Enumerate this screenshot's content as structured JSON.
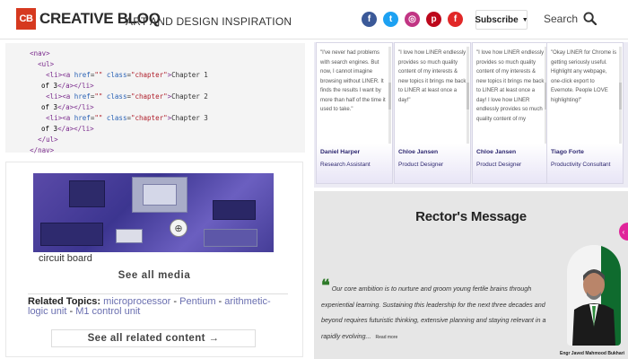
{
  "header": {
    "logo_mark": "CB",
    "logo_text": "CREATIVE BLOQ",
    "tagline": "ART AND DESIGN INSPIRATION",
    "social": [
      {
        "icon": "facebook-icon",
        "glyph": "f",
        "color": "#3b5998"
      },
      {
        "icon": "twitter-icon",
        "glyph": "t",
        "color": "#1da1f2"
      },
      {
        "icon": "instagram-icon",
        "glyph": "◎",
        "color": "#c13584"
      },
      {
        "icon": "pinterest-icon",
        "glyph": "p",
        "color": "#bd081c"
      },
      {
        "icon": "flipboard-icon",
        "glyph": "f",
        "color": "#e12828"
      }
    ],
    "subscribe_label": "Subscribe",
    "subscribe_caret": "▼",
    "search_label": "Search"
  },
  "code": {
    "lines": [
      {
        "indent": "      ",
        "open": "<nav>",
        "rest": ""
      },
      {
        "indent": "        ",
        "open": "<ul>",
        "rest": ""
      },
      {
        "indent": "          ",
        "li": true,
        "text": "Chapter 1",
        "tail": "of 3"
      },
      {
        "indent": "          ",
        "li": true,
        "text": "Chapter 2",
        "tail": "of 3"
      },
      {
        "indent": "          ",
        "li": true,
        "text": "Chapter 3",
        "tail": "of 3"
      },
      {
        "indent": "        ",
        "open": "</ul>",
        "rest": ""
      },
      {
        "indent": "      ",
        "open": "</nav>",
        "rest": ""
      }
    ]
  },
  "media": {
    "caption": "circuit board",
    "see_all_media": "See all media",
    "related_label": "Related Topics:",
    "related_topics": [
      "microprocessor",
      "Pentium",
      "arithmetic-logic unit",
      "M1 control unit"
    ],
    "see_all_related": "See all related content →"
  },
  "testimonials": [
    {
      "quote": "\"I've never had problems with search engines. But now, I cannot imagine browsing without LINER. It finds the results I want by more than half of the time it used to take.\"",
      "name": "Daniel Harper",
      "role": "Research Assistant"
    },
    {
      "quote": "\"I love how LINER endlessly provides so much quality content of my interests & new topics it brings me back to LINER at least once a day!\"",
      "name": "Chloe Jansen",
      "role": "Product Designer"
    },
    {
      "quote": "\"I love how LINER endlessly provides so much quality content of my interests & new topics it brings me back to LINER at least once a day! I love how LINER endlessly provides so much quality content of my",
      "name": "Chloe Jansen",
      "role": "Product Designer"
    },
    {
      "quote": "\"Okay LINER for Chrome is getting seriously useful. Highlight any webpage, one-click export to Evernote. People LOVE highlighting!\"",
      "name": "Tiago Forte",
      "role": "Productivity Consultant"
    }
  ],
  "rector": {
    "title": "Rector's Message",
    "message": "Our core ambition is to nurture and groom young fertile brains through experiential learning. Sustaining this leadership for the next three decades and beyond requires futuristic thinking, extensive planning and staying relevant in a rapidly evolving...",
    "read_more": "Read more",
    "name": "Engr Javed Mahmood Bukhari"
  }
}
